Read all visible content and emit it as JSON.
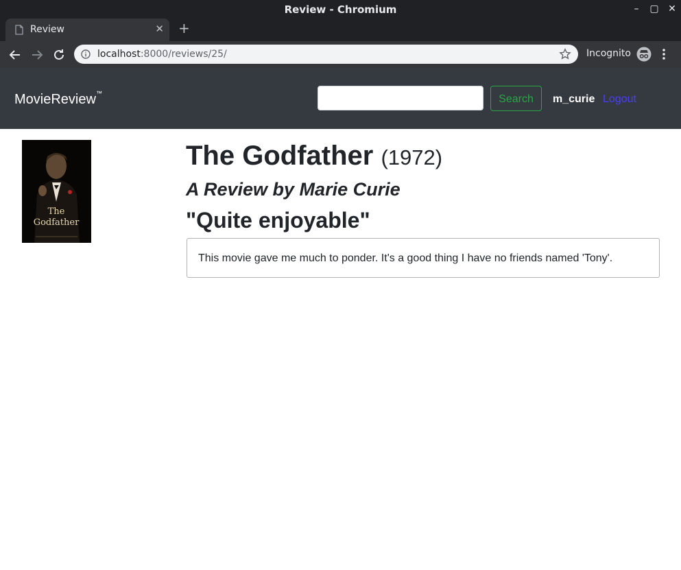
{
  "window": {
    "title": "Review - Chromium"
  },
  "tab": {
    "label": "Review"
  },
  "address": {
    "host": "localhost",
    "rest": ":8000/reviews/25/"
  },
  "browser": {
    "incognito_label": "Incognito"
  },
  "site": {
    "brand": "MovieReview",
    "brand_mark": "™",
    "search_value": "",
    "search_button": "Search",
    "username": "m_curie",
    "logout": "Logout"
  },
  "movie": {
    "title": "The Godfather",
    "year": "(1972)",
    "poster_text_1": "The",
    "poster_text_2": "Godfather"
  },
  "review": {
    "byline": "A Review by Marie Curie",
    "headline": "\"Quite enjoyable\"",
    "body": "This movie gave me much to ponder. It's a good thing I have no friends named 'Tony'."
  },
  "colors": {
    "navbar": "#343a40",
    "search_green": "#28a745",
    "logout_link": "#4a3dff"
  }
}
